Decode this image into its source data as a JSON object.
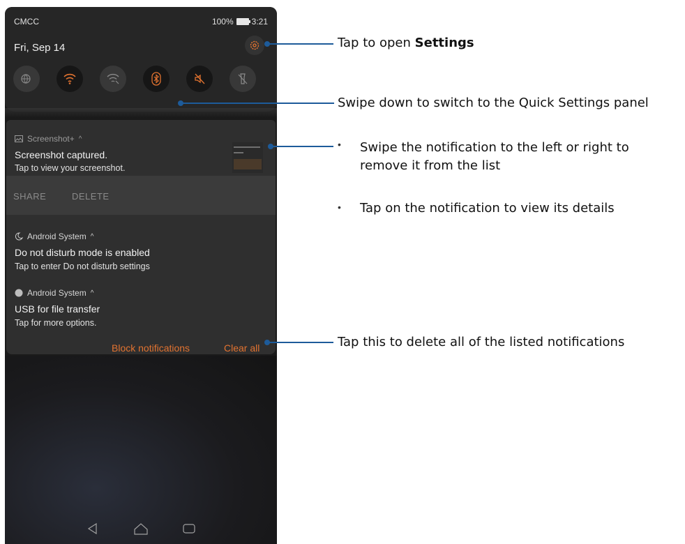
{
  "status_bar": {
    "carrier": "CMCC",
    "battery": "100%",
    "time": "3:21"
  },
  "quick_settings": {
    "date": "Fri, Sep 14",
    "tiles": [
      "globe-icon",
      "wifi-icon",
      "wifi-off-icon",
      "bluetooth-icon",
      "mute-icon",
      "flashlight-off-icon"
    ],
    "accent_color": "#e27330"
  },
  "notifications": {
    "screenshot": {
      "app": "Screenshot+",
      "title": "Screenshot captured.",
      "text": "Tap to view your screenshot.",
      "actions": [
        "SHARE",
        "DELETE"
      ]
    },
    "dnd": {
      "app": "Android System",
      "title": "Do not disturb mode is enabled",
      "text": "Tap to enter Do not disturb settings"
    },
    "usb": {
      "app": "Android System",
      "title": "USB for file transfer",
      "text": "Tap for more options."
    },
    "block_label": "Block notifications",
    "clear_label": "Clear all"
  },
  "annotations": {
    "settings_prefix": "Tap to open ",
    "settings_bold": "Settings",
    "swipe_down": "Swipe down to switch to the Quick Settings panel",
    "swipe_notification": "Swipe the notification to the left or right to remove it from the list",
    "tap_notification": "Tap on the notification to view its details",
    "clear_all": "Tap this to delete all of the listed notifications",
    "bullet": "•",
    "line_color": "#1d5b9a"
  }
}
